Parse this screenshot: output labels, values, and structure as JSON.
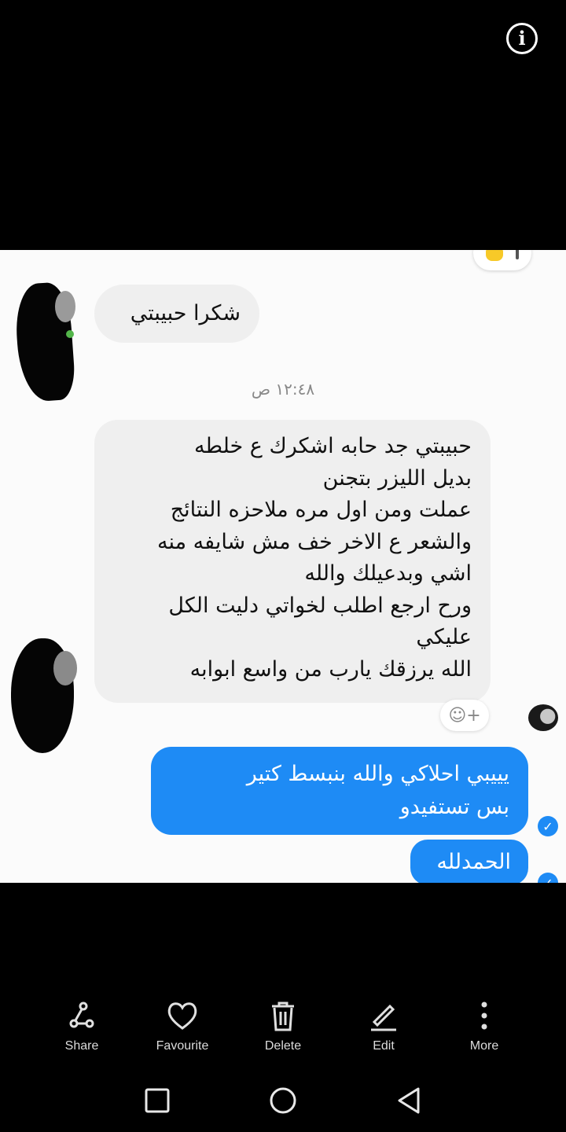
{
  "viewer": {
    "info_icon": "info-icon"
  },
  "chat": {
    "msg1": "شكرا حبيبتي",
    "timestamp": "١٢:٤٨ ص",
    "msg2": "حبيبتي جد حابه اشكرك ع خلطه\nبديل الليزر بتجنن\nعملت ومن اول مره ملاحزه النتائج\nوالشعر ع الاخر خف مش شايفه منه\nاشي  وبدعيلك والله\nورح ارجع اطلب لخواتي دليت الكل\nعليكي\nالله يرزقك يارب من واسع ابوابه",
    "msg3": "يييبي احلاكي والله بنبسط كتير\nبس تستفيدو",
    "msg4": "الحمدلله",
    "react_icon": "☺+",
    "incoming_bubble_color": "#efefef",
    "outgoing_bubble_color": "#1e8bf5"
  },
  "toolbar": {
    "share": "Share",
    "favourite": "Favourite",
    "delete": "Delete",
    "edit": "Edit",
    "more": "More"
  },
  "nav": {
    "recents": "square-icon",
    "home": "circle-icon",
    "back": "triangle-back-icon"
  }
}
